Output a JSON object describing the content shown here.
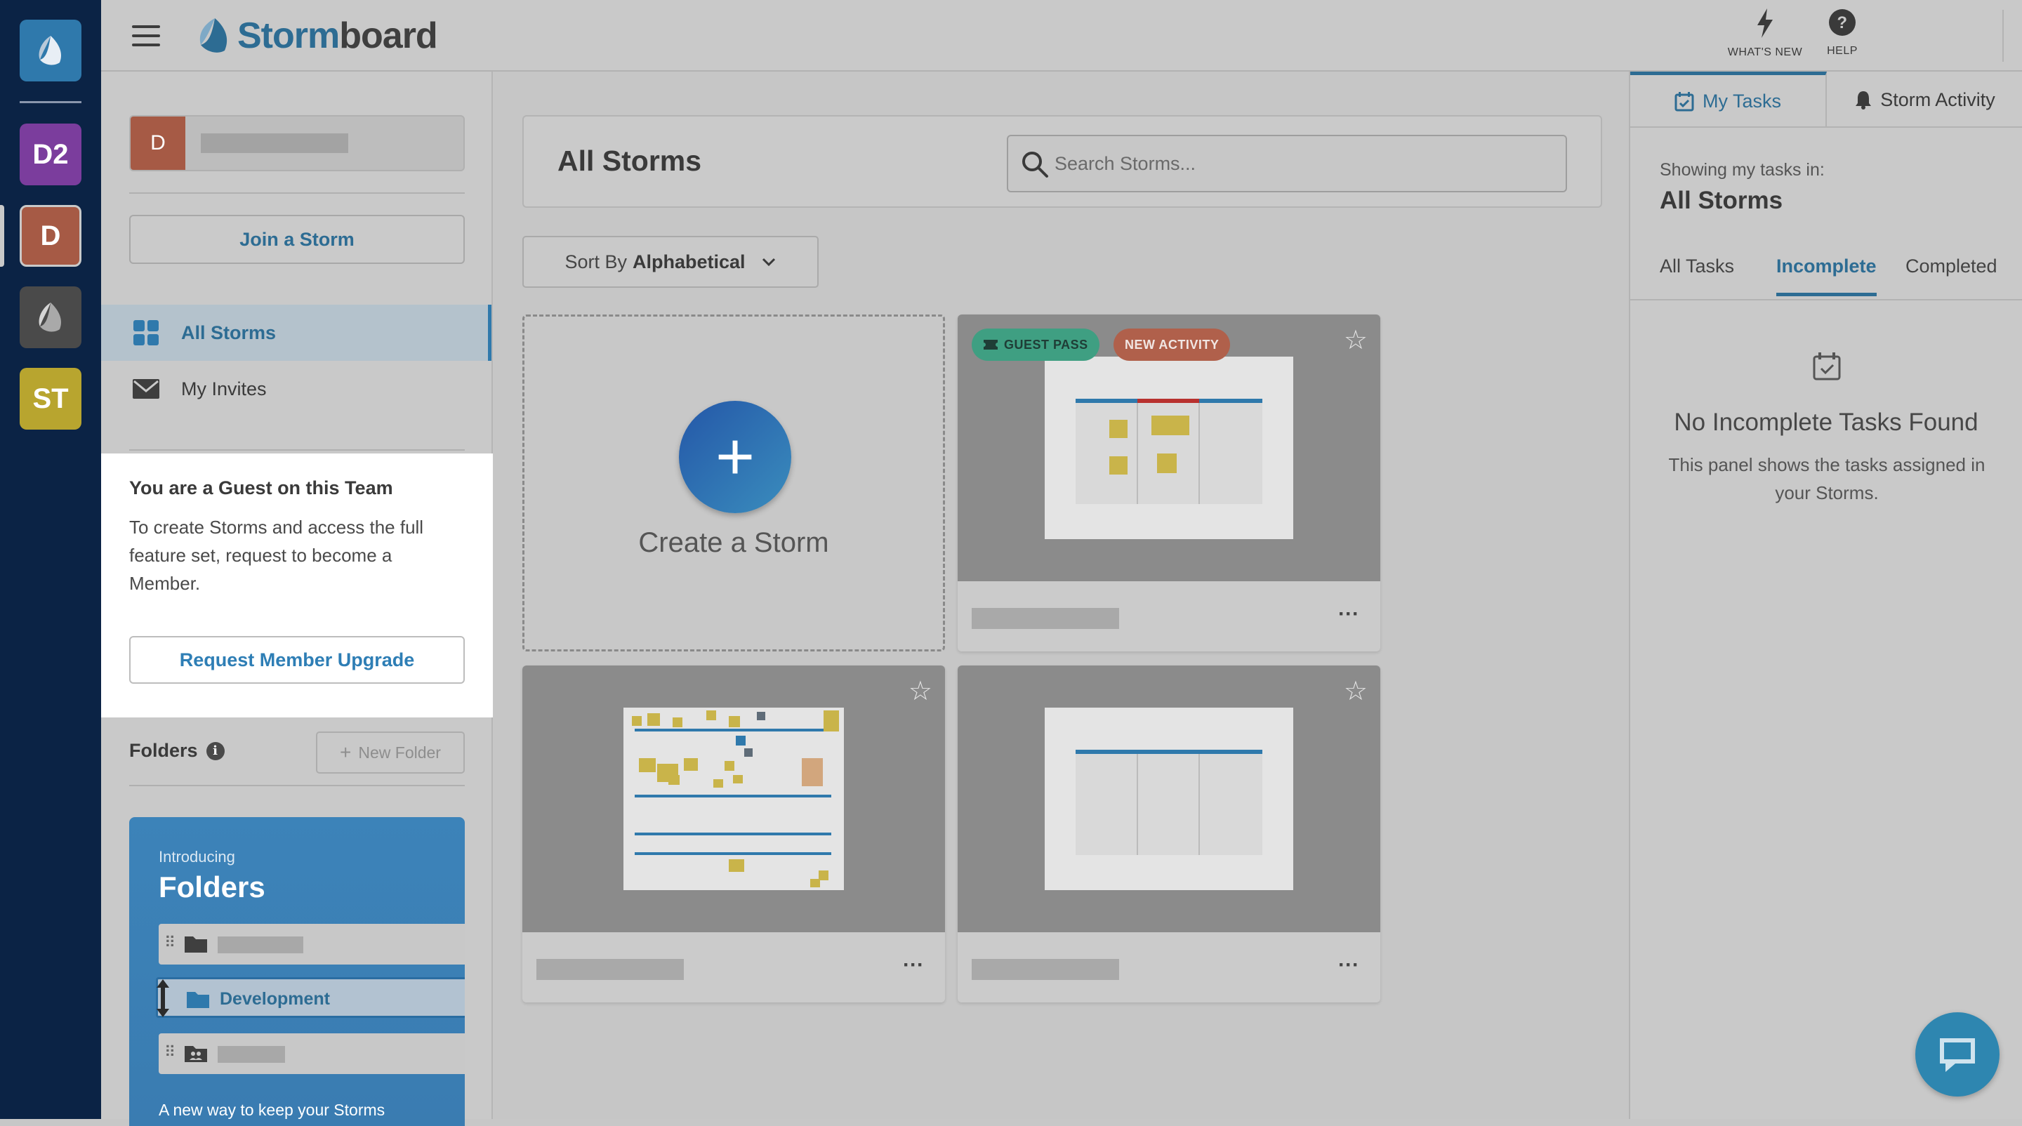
{
  "rail": {
    "tiles": [
      {
        "label": "",
        "color": "#2f79ac"
      },
      {
        "label": "D2",
        "color": "#7b3d9d"
      },
      {
        "label": "D",
        "color": "#a65a45"
      },
      {
        "label": "",
        "color": "#4a4a4a"
      },
      {
        "label": "ST",
        "color": "#b8a52f"
      }
    ]
  },
  "header": {
    "logo_part1": "Storm",
    "logo_part2": "board",
    "whats_new": "WHAT'S NEW",
    "help": "HELP"
  },
  "sidebar": {
    "team_letter": "D",
    "join_label": "Join a Storm",
    "nav": [
      {
        "label": "All Storms",
        "icon": "grid-icon"
      },
      {
        "label": "My Invites",
        "icon": "envelope-icon"
      }
    ],
    "guest": {
      "title": "You are a Guest on this Team",
      "body": "To create Storms and access the full feature set, request to become a Member.",
      "button": "Request Member Upgrade"
    },
    "folders_label": "Folders",
    "new_folder_label": "New Folder",
    "intro": {
      "small": "Introducing",
      "big": "Folders",
      "highlight_folder": "Development",
      "footer": "A new way to keep your Storms"
    }
  },
  "main": {
    "title": "All Storms",
    "search_placeholder": "Search Storms...",
    "sort_prefix": "Sort By",
    "sort_value": "Alphabetical",
    "create_label": "Create a Storm",
    "badge_guest": "GUEST PASS",
    "badge_new": "NEW ACTIVITY"
  },
  "right_panel": {
    "tab_tasks": "My Tasks",
    "tab_activity": "Storm Activity",
    "showing": "Showing my tasks in:",
    "scope": "All Storms",
    "filters": [
      "All Tasks",
      "Incomplete",
      "Completed"
    ],
    "active_filter": "Incomplete",
    "empty_title": "No Incomplete Tasks Found",
    "empty_desc": "This panel shows the tasks assigned in your Storms."
  },
  "colors": {
    "accent": "#2d6c93",
    "rail": "#0b2345"
  }
}
